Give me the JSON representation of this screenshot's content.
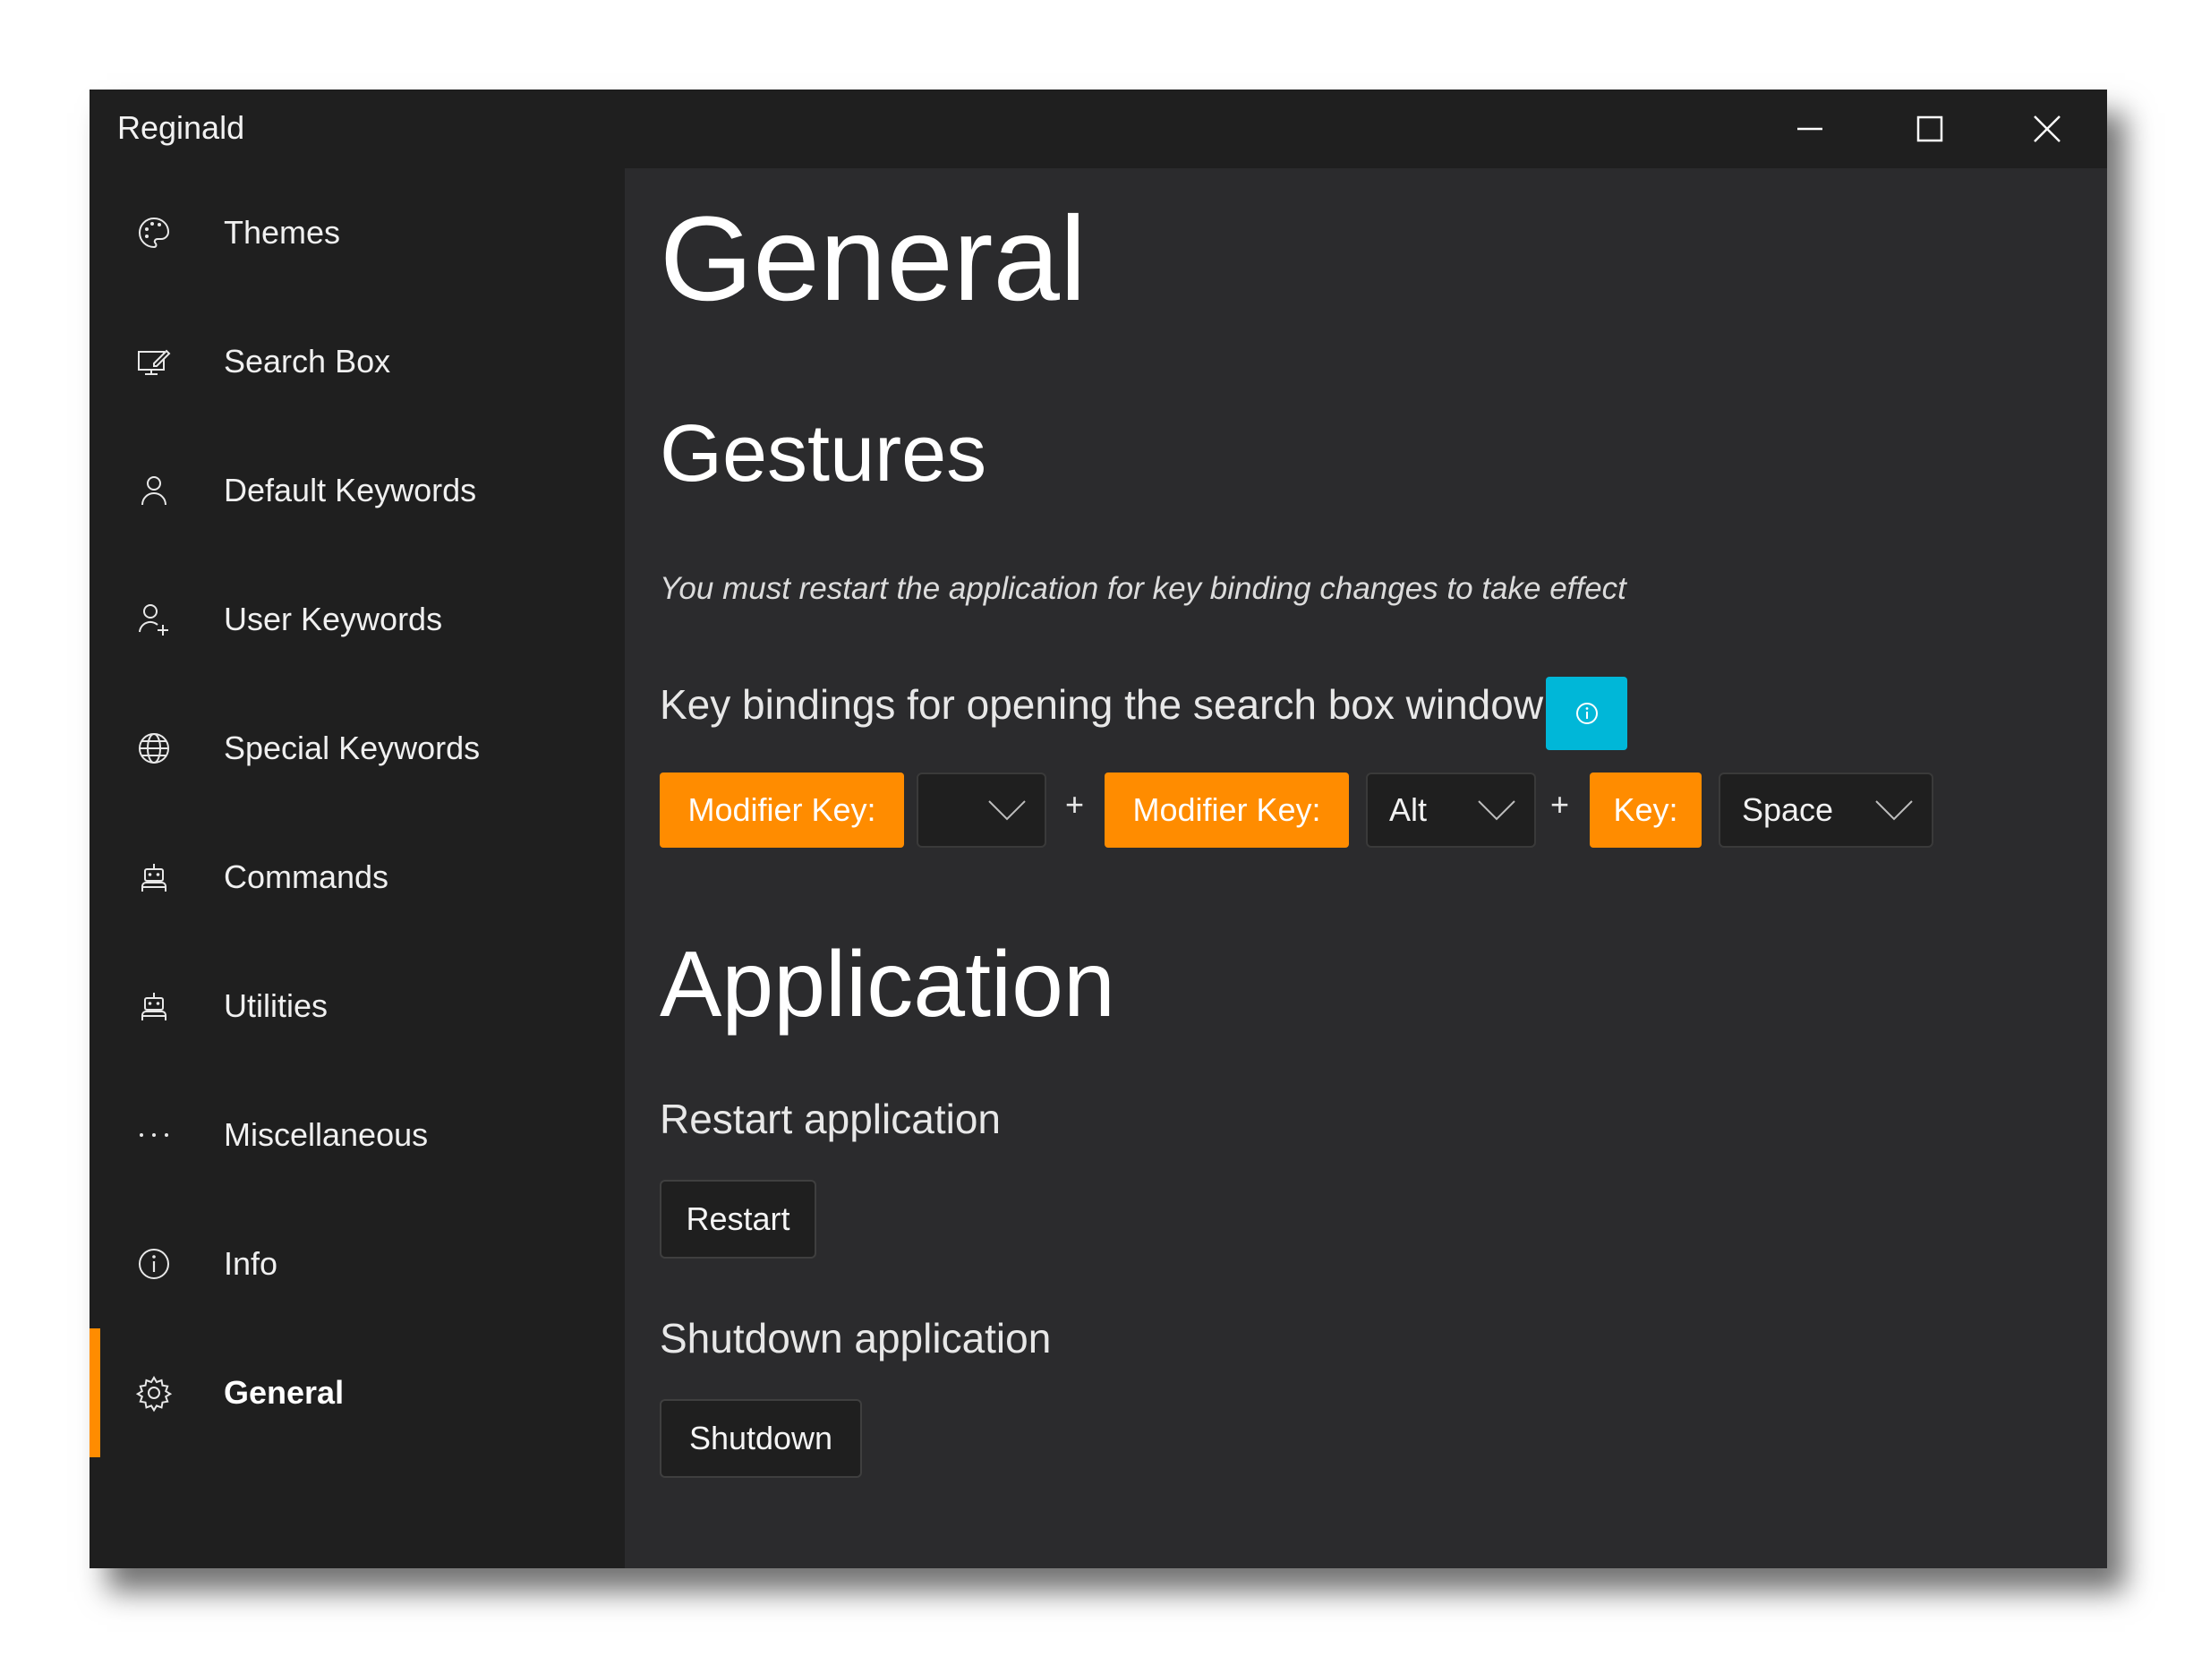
{
  "window": {
    "title": "Reginald",
    "controls": [
      "minimize-icon",
      "maximize-icon",
      "close-icon"
    ]
  },
  "sidebar": {
    "items": [
      {
        "label": "Themes",
        "icon": "palette-icon"
      },
      {
        "label": "Search Box",
        "icon": "monitor-edit-icon"
      },
      {
        "label": "Default Keywords",
        "icon": "person-icon"
      },
      {
        "label": "User Keywords",
        "icon": "person-add-icon"
      },
      {
        "label": "Special Keywords",
        "icon": "globe-icon"
      },
      {
        "label": "Commands",
        "icon": "robot-icon"
      },
      {
        "label": "Utilities",
        "icon": "robot-icon"
      },
      {
        "label": "Miscellaneous",
        "icon": "more-icon"
      },
      {
        "label": "Info",
        "icon": "info-icon"
      },
      {
        "label": "General",
        "icon": "gear-icon",
        "selected": true
      }
    ]
  },
  "main": {
    "title": "General",
    "gestures": {
      "heading": "Gestures",
      "note": "You must restart the application for key binding changes to take effect",
      "binding_label": "Key bindings for opening the search box window",
      "modifier1": {
        "label": "Modifier Key:",
        "value": ""
      },
      "modifier2": {
        "label": "Modifier Key:",
        "value": "Alt"
      },
      "key": {
        "label": "Key:",
        "value": "Space"
      },
      "plus": "+"
    },
    "application": {
      "heading": "Application",
      "restart_label": "Restart application",
      "restart_button": "Restart",
      "shutdown_label": "Shutdown application",
      "shutdown_button": "Shutdown"
    }
  },
  "colors": {
    "accent": "#ff8c00",
    "info_button": "#00b7d8",
    "sidebar_bg": "#1f1f1f",
    "content_bg": "#2b2b2d"
  }
}
